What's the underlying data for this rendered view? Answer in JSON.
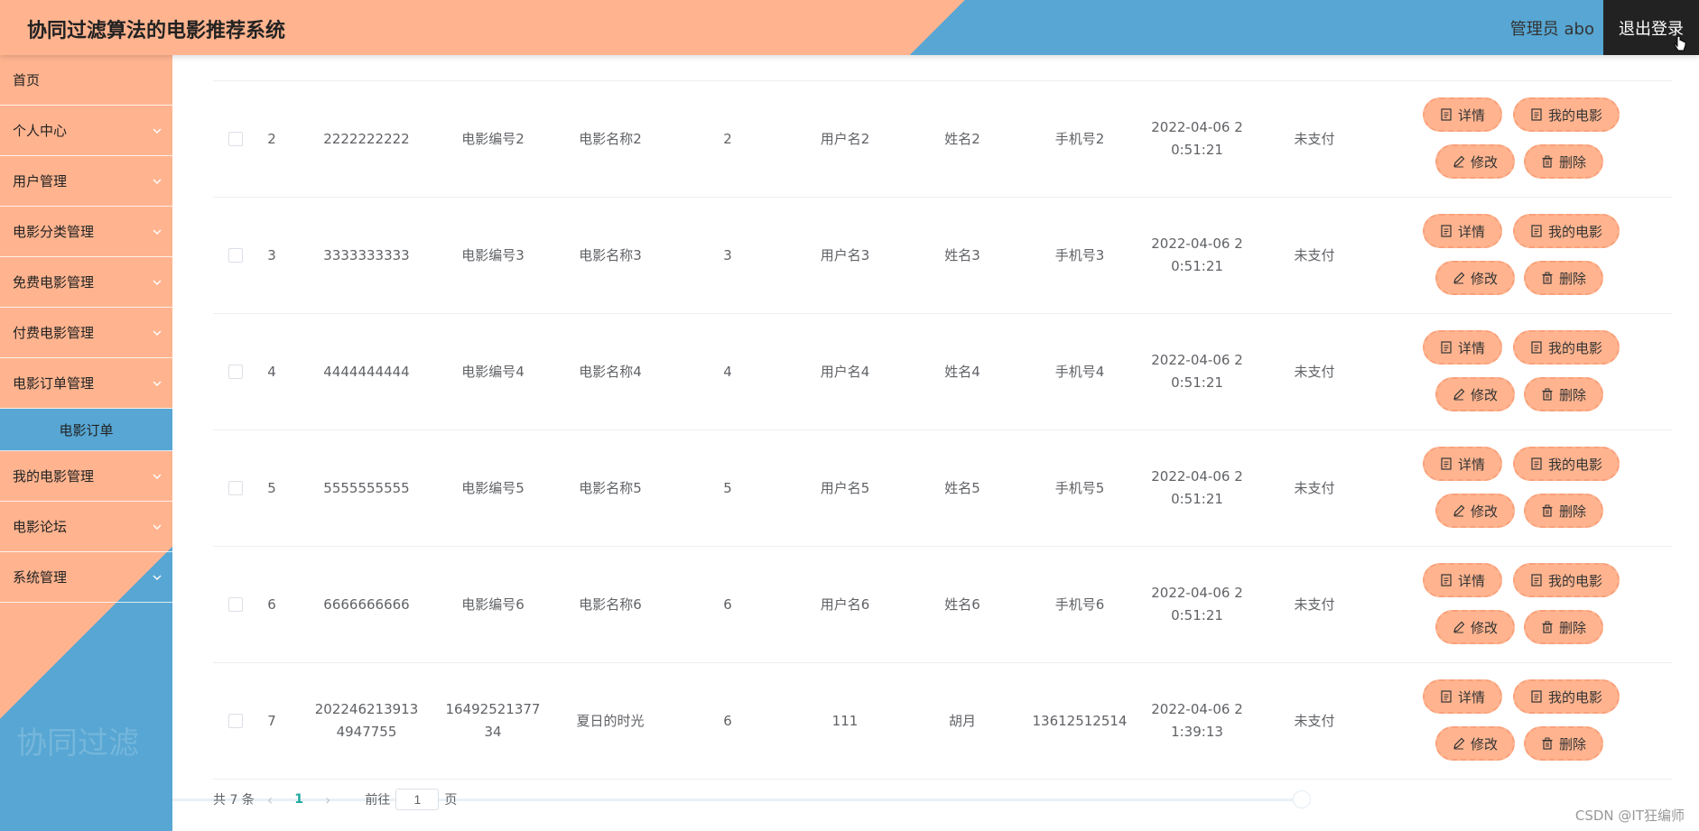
{
  "header": {
    "title": "协同过滤算法的电影推荐系统",
    "admin": "管理员 abo",
    "logout": "退出登录"
  },
  "sidebar": {
    "items": [
      {
        "label": "首页",
        "chevron": false
      },
      {
        "label": "个人中心",
        "chevron": true
      },
      {
        "label": "用户管理",
        "chevron": true
      },
      {
        "label": "电影分类管理",
        "chevron": true
      },
      {
        "label": "免费电影管理",
        "chevron": true
      },
      {
        "label": "付费电影管理",
        "chevron": true
      },
      {
        "label": "电影订单管理",
        "chevron": true
      }
    ],
    "active_sub": "电影订单",
    "items_after": [
      {
        "label": "我的电影管理",
        "chevron": true
      },
      {
        "label": "电影论坛",
        "chevron": true
      },
      {
        "label": "系统管理",
        "chevron": true
      }
    ],
    "watermark": "协同过滤"
  },
  "rows": [
    {
      "idx": "2",
      "order": "2222222222",
      "movie_no": "电影编号2",
      "movie_name": "电影名称2",
      "qty": "2",
      "user": "用户名2",
      "name": "姓名2",
      "phone": "手机号2",
      "time": "2022-04-06 2\n0:51:21",
      "status": "未支付"
    },
    {
      "idx": "3",
      "order": "3333333333",
      "movie_no": "电影编号3",
      "movie_name": "电影名称3",
      "qty": "3",
      "user": "用户名3",
      "name": "姓名3",
      "phone": "手机号3",
      "time": "2022-04-06 2\n0:51:21",
      "status": "未支付"
    },
    {
      "idx": "4",
      "order": "4444444444",
      "movie_no": "电影编号4",
      "movie_name": "电影名称4",
      "qty": "4",
      "user": "用户名4",
      "name": "姓名4",
      "phone": "手机号4",
      "time": "2022-04-06 2\n0:51:21",
      "status": "未支付"
    },
    {
      "idx": "5",
      "order": "5555555555",
      "movie_no": "电影编号5",
      "movie_name": "电影名称5",
      "qty": "5",
      "user": "用户名5",
      "name": "姓名5",
      "phone": "手机号5",
      "time": "2022-04-06 2\n0:51:21",
      "status": "未支付"
    },
    {
      "idx": "6",
      "order": "6666666666",
      "movie_no": "电影编号6",
      "movie_name": "电影名称6",
      "qty": "6",
      "user": "用户名6",
      "name": "姓名6",
      "phone": "手机号6",
      "time": "2022-04-06 2\n0:51:21",
      "status": "未支付"
    },
    {
      "idx": "7",
      "order": "202246213913\n4947755",
      "movie_no": "16492521377\n34",
      "movie_name": "夏日的时光",
      "qty": "6",
      "user": "111",
      "name": "胡月",
      "phone": "13612512514",
      "time": "2022-04-06 2\n1:39:13",
      "status": "未支付"
    }
  ],
  "actions": {
    "detail": "详情",
    "my_movie": "我的电影",
    "edit": "修改",
    "delete": "删除"
  },
  "pagination": {
    "total": "共 7 条",
    "prev": "‹",
    "current": "1",
    "next": "›",
    "goto": "前往",
    "page_input": "1",
    "page_suffix": "页"
  },
  "colors": {
    "accent": "#ffb48f",
    "blue": "#57a6d3",
    "dark": "#222222"
  },
  "watermark": "CSDN @IT狂编师"
}
